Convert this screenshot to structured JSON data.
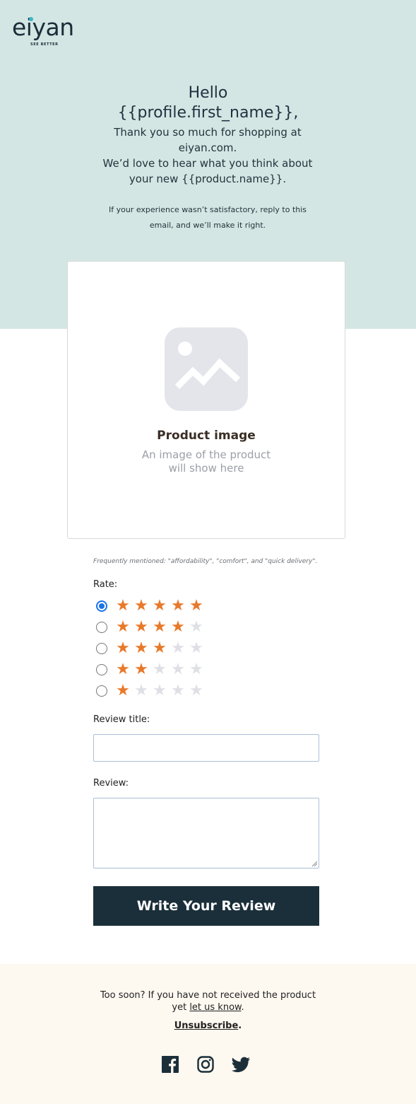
{
  "brand": {
    "name": "eiyan",
    "tagline": "SEE BETTER"
  },
  "hero": {
    "greeting": "Hello",
    "name_line": "{{profile.first_name}},",
    "thanks": "Thank you so much for shopping at eiyan.com.",
    "ask": "We’d love to hear what you think about your new {{product.name}}.",
    "note": "If your experience wasn’t satisfactory, reply to this email, and we’ll make it right."
  },
  "product_card": {
    "title": "Product image",
    "subtitle_line1": "An image of the product",
    "subtitle_line2": "will show here"
  },
  "form": {
    "frequently_mentioned": "Frequently mentioned: \"affordability\", \"comfort\", and \"quick delivery\".",
    "rate_label": "Rate:",
    "ratings": [
      5,
      4,
      3,
      2,
      1
    ],
    "selected_rating": 5,
    "review_title_label": "Review title:",
    "review_title_value": "",
    "review_label": "Review:",
    "review_value": "",
    "submit_label": "Write Your Review",
    "colors": {
      "star_filled": "#e8792a",
      "star_empty": "#dfe0e6",
      "button": "#1b2f3a"
    }
  },
  "footer": {
    "too_soon_text": "Too soon? If you have not received the product yet",
    "let_us_know": "let us know",
    "period": ".",
    "unsubscribe": "Unsubscribe",
    "icons": [
      "facebook-icon",
      "instagram-icon",
      "twitter-icon"
    ]
  }
}
